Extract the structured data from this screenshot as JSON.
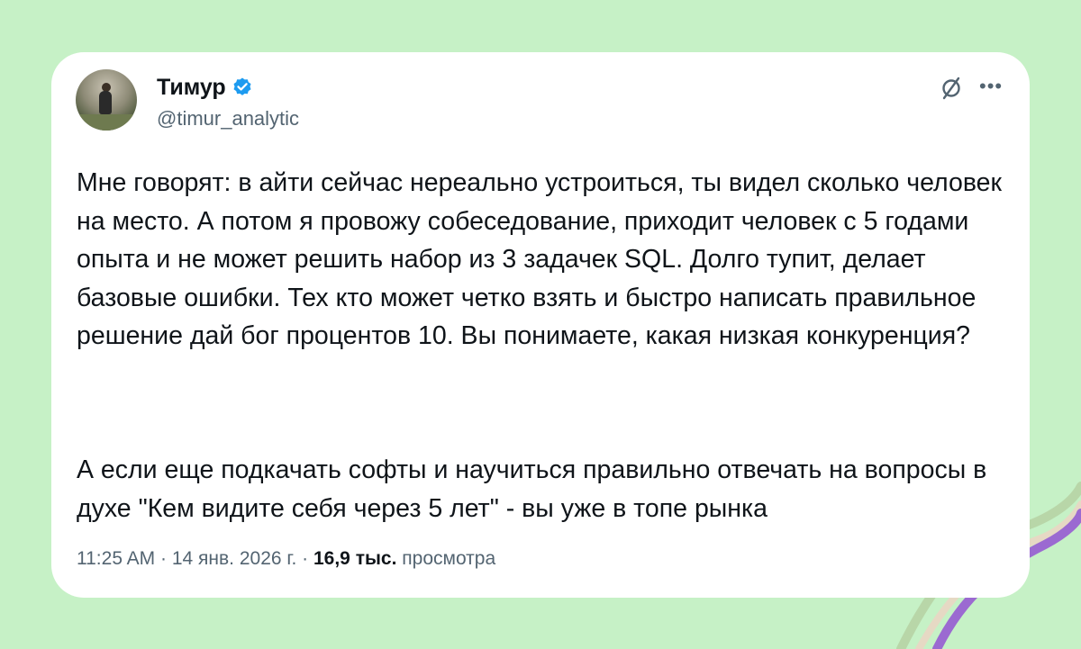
{
  "tweet": {
    "author_name": "Тимур",
    "handle": "@timur_analytic",
    "paragraphs": [
      "Мне говорят: в айти сейчас нереально устроиться, ты видел сколько человек на место. А потом я провожу собеседование, приходит человек с 5 годами опыта и не может решить набор из 3 задачек SQL. Долго тупит, делает базовые ошибки. Тех кто может четко взять и быстро написать правильное решение дай бог процентов 10. Вы понимаете, какая низкая конкуренция?",
      "А если еще подкачать софты и научиться правильно отвечать на вопросы в духе \"Кем видите себя через 5 лет\" - вы уже в топе рынка"
    ],
    "time": "11:25 AM",
    "date": "14 янв. 2026 г.",
    "views_count": "16,9 тыс.",
    "views_label": "просмотра"
  },
  "icons": {
    "verified": "verified-badge-icon",
    "grok": "grok-slash-icon",
    "more": "more-dots-icon"
  },
  "colors": {
    "background": "#c6f1c6",
    "card": "#ffffff",
    "text": "#0f1419",
    "secondary_text": "#536471",
    "verified_blue": "#1d9bf0",
    "ribbon_purple": "#9b6ad1",
    "ribbon_green": "#b8d6a8",
    "ribbon_beige": "#e6d9c4"
  }
}
